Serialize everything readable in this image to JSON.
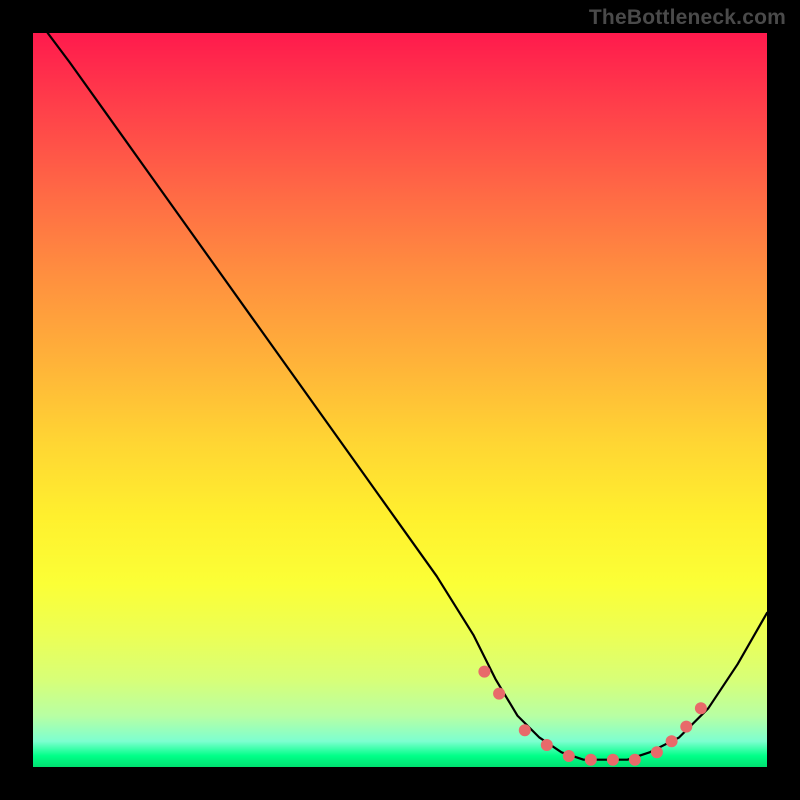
{
  "watermark": "TheBottleneck.com",
  "chart_data": {
    "type": "line",
    "title": "",
    "xlabel": "",
    "ylabel": "",
    "xlim": [
      0,
      100
    ],
    "ylim": [
      0,
      100
    ],
    "series": [
      {
        "name": "curve",
        "x": [
          2,
          5,
          10,
          15,
          20,
          25,
          30,
          35,
          40,
          45,
          50,
          55,
          60,
          63,
          66,
          69,
          72,
          75,
          78,
          81,
          84,
          88,
          92,
          96,
          100
        ],
        "y": [
          100,
          96,
          89,
          82,
          75,
          68,
          61,
          54,
          47,
          40,
          33,
          26,
          18,
          12,
          7,
          4,
          2,
          1,
          1,
          1,
          2,
          4,
          8,
          14,
          21
        ]
      }
    ],
    "markers": {
      "name": "dots",
      "color": "#e86a6a",
      "x": [
        61.5,
        63.5,
        67,
        70,
        73,
        76,
        79,
        82,
        85,
        87,
        89,
        91
      ],
      "y": [
        13,
        10,
        5,
        3,
        1.5,
        1,
        1,
        1,
        2,
        3.5,
        5.5,
        8
      ]
    },
    "background_gradient": {
      "top": "#ff1a4d",
      "mid": "#ffd633",
      "bottom": "#00ff88"
    }
  }
}
